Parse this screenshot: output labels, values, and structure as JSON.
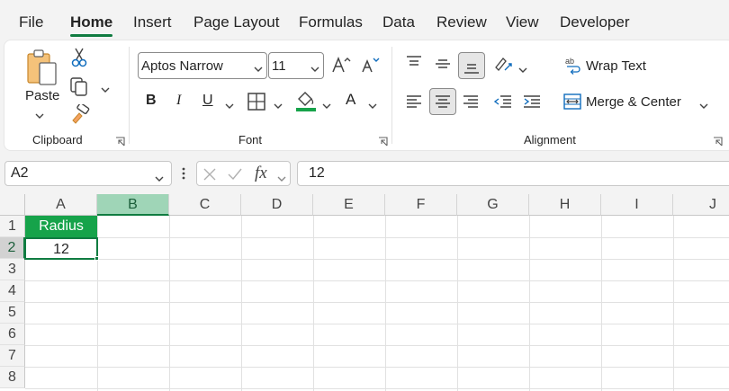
{
  "menu": {
    "tabs": [
      {
        "label": "File"
      },
      {
        "label": "Home"
      },
      {
        "label": "Insert"
      },
      {
        "label": "Page Layout"
      },
      {
        "label": "Formulas"
      },
      {
        "label": "Data"
      },
      {
        "label": "Review"
      },
      {
        "label": "View"
      },
      {
        "label": "Developer"
      }
    ],
    "active": "Home"
  },
  "ribbon": {
    "clipboard": {
      "paste_label": "Paste",
      "group_label": "Clipboard"
    },
    "font": {
      "font_name": "Aptos Narrow",
      "font_size": "11",
      "bold_label": "B",
      "italic_label": "I",
      "underline_label": "U",
      "font_color_label": "A",
      "group_label": "Font"
    },
    "alignment": {
      "wrap_text_label": "Wrap Text",
      "merge_center_label": "Merge & Center",
      "group_label": "Alignment"
    }
  },
  "formula_bar": {
    "name_box": "A2",
    "formula": "12",
    "fx_label": "fx"
  },
  "sheet": {
    "columns": [
      "A",
      "B",
      "C",
      "D",
      "E",
      "F",
      "G",
      "H",
      "I",
      "J"
    ],
    "rows": [
      "1",
      "2",
      "3",
      "4",
      "5",
      "6",
      "7",
      "8"
    ],
    "selected_column": "B",
    "selected_row": "2",
    "active_cell": "A2",
    "cells": {
      "A1": "Radius",
      "A2": "12"
    }
  },
  "colors": {
    "accent": "#107c41",
    "header_cell_fill": "#16a34a",
    "font_color_bar": "#16a34a"
  }
}
